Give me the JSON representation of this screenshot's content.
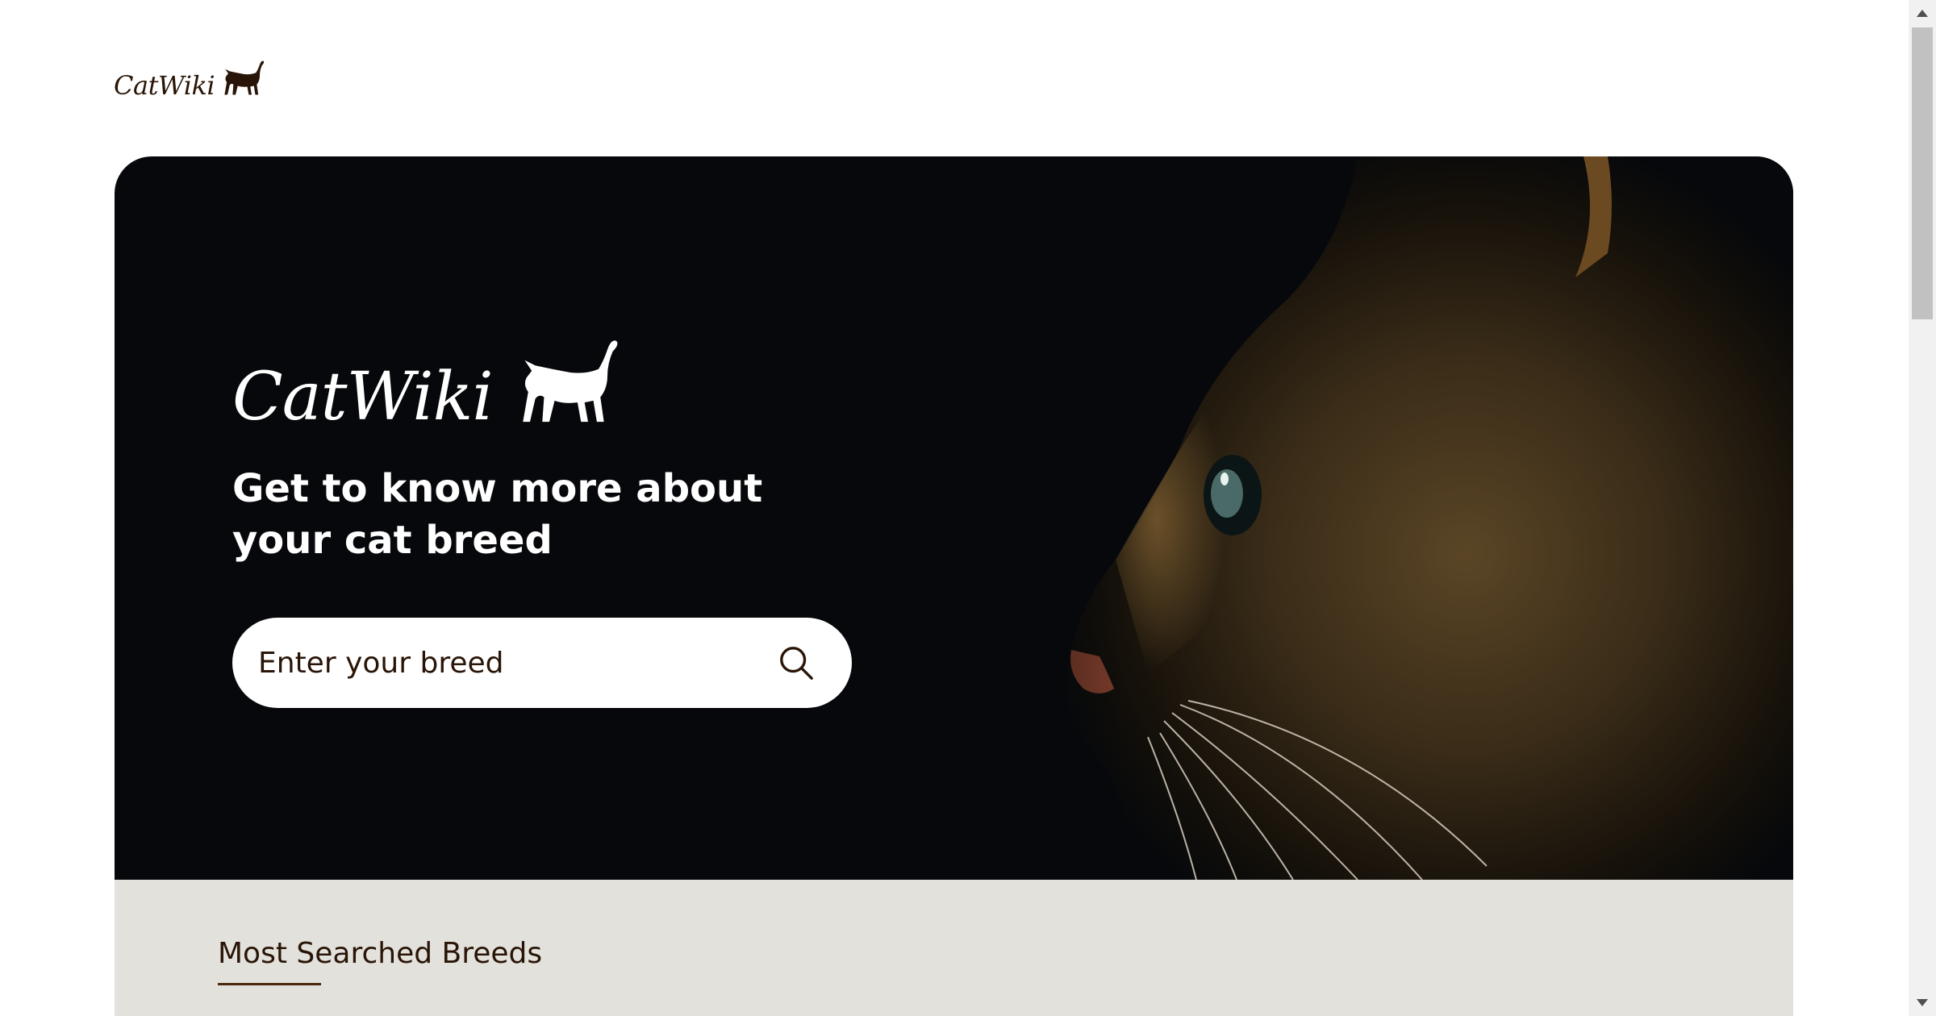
{
  "header": {
    "logo_text": "CatWiki"
  },
  "hero": {
    "logo_text": "CatWiki",
    "tagline": "Get to know more about your cat breed",
    "search": {
      "placeholder": "Enter your breed"
    }
  },
  "breeds_section": {
    "title": "Most Searched Breeds"
  },
  "colors": {
    "brand_dark": "#291507",
    "hero_background": "#06080b",
    "section_background": "#e3e1dc"
  },
  "icons": {
    "logo": "cat-silhouette-icon",
    "search": "search-icon"
  }
}
